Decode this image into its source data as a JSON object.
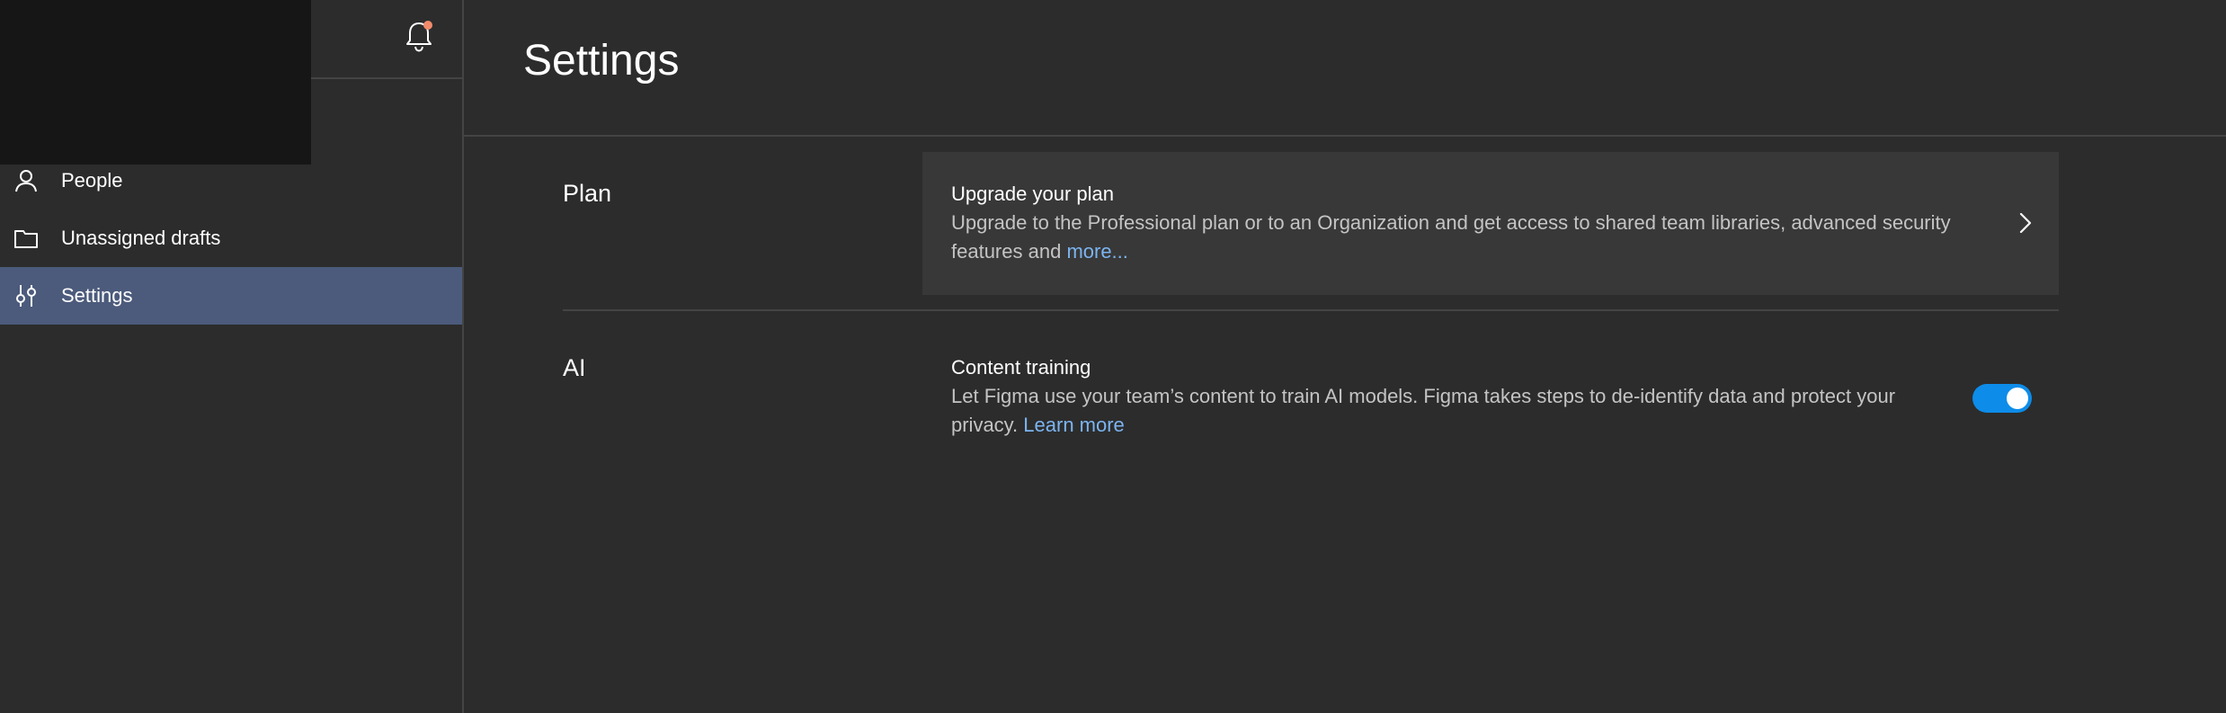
{
  "sidebar": {
    "items": [
      {
        "label": "People",
        "icon": "person-icon",
        "active": false
      },
      {
        "label": "Unassigned drafts",
        "icon": "folder-icon",
        "active": false
      },
      {
        "label": "Settings",
        "icon": "sliders-icon",
        "active": true
      }
    ],
    "notification_icon": "bell-icon",
    "notification_dot_color": "#f28b6b"
  },
  "page": {
    "title": "Settings"
  },
  "sections": {
    "plan": {
      "label": "Plan",
      "card_title": "Upgrade your plan",
      "card_desc": "Upgrade to the Professional plan or to an Organization and get access to shared team libraries, advanced security features and ",
      "card_link": "more...",
      "chevron_icon": "chevron-right-icon"
    },
    "ai": {
      "label": "AI",
      "title": "Content training",
      "desc": "Let Figma use your team’s content to train AI models. Figma takes steps to de-identify data and protect your privacy. ",
      "link": "Learn more",
      "toggle_on": true
    }
  },
  "colors": {
    "background": "#2c2c2c",
    "active_nav": "#4c5b7c",
    "card": "#383838",
    "link": "#7cb4f0",
    "toggle": "#0d8ce9"
  }
}
